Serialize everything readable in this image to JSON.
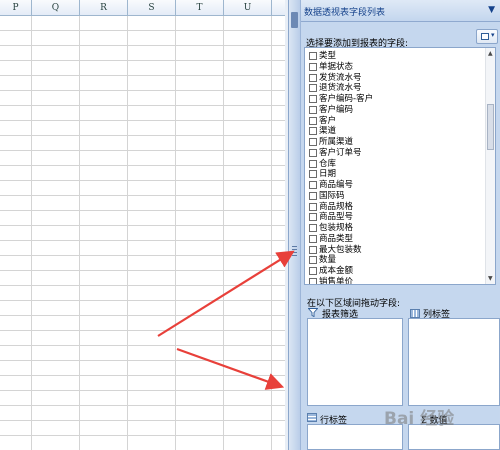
{
  "sheet": {
    "columns": [
      "P",
      "Q",
      "R",
      "S",
      "T",
      "U"
    ]
  },
  "pivot_pane": {
    "title": "数据透视表字段列表",
    "menu_glyph": "▼",
    "field_prompt": "选择要添加到报表的字段:",
    "fields": [
      "类型",
      "单据状态",
      "发货流水号",
      "退货流水号",
      "客户编码-客户",
      "客户编码",
      "客户",
      "渠道",
      "所属渠道",
      "客户订单号",
      "仓库",
      "日期",
      "商品编号",
      "国际码",
      "商品规格",
      "商品型号",
      "包装规格",
      "商品类型",
      "最大包装数",
      "数量",
      "成本金额",
      "销售单价"
    ],
    "drag_prompt": "在以下区域间拖动字段:",
    "areas": {
      "filter": "报表筛选",
      "column": "列标签",
      "row": "行标签",
      "values": "Σ 数值"
    }
  },
  "annotation": {
    "arrow_color": "#e8403a"
  },
  "watermark": "Bai 经验"
}
